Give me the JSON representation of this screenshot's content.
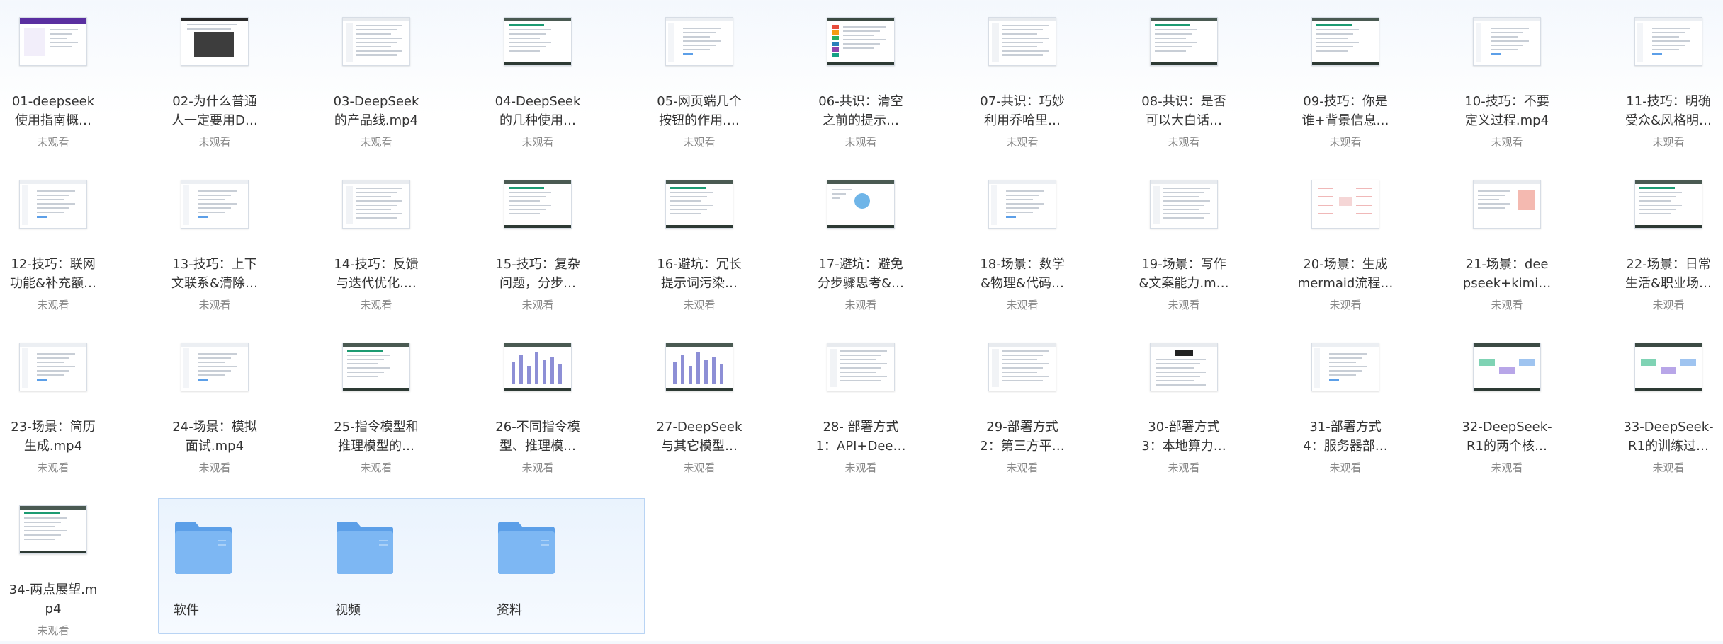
{
  "status_label": "未观看",
  "videos": [
    {
      "line1": "01-deepseek",
      "line2": "使用指南概…",
      "theme": "purple"
    },
    {
      "line1": "02-为什么普通",
      "line2": "人一定要用D…",
      "theme": "photo"
    },
    {
      "line1": "03-DeepSeek",
      "line2": "的产品线.mp4",
      "theme": "doc"
    },
    {
      "line1": "04-DeepSeek",
      "line2": "的几种使用…",
      "theme": "green"
    },
    {
      "line1": "05-网页端几个",
      "line2": "按钮的作用.…",
      "theme": "light"
    },
    {
      "line1": "06-共识：清空",
      "line2": "之前的提示…",
      "theme": "list"
    },
    {
      "line1": "07-共识：巧妙",
      "line2": "利用乔哈里…",
      "theme": "doc"
    },
    {
      "line1": "08-共识：是否",
      "line2": "可以大白话…",
      "theme": "green"
    },
    {
      "line1": "09-技巧：你是",
      "line2": "谁+背景信息…",
      "theme": "green"
    },
    {
      "line1": "10-技巧：不要",
      "line2": "定义过程.mp4",
      "theme": "light"
    },
    {
      "line1": "11-技巧：明确",
      "line2": "受众&风格明…",
      "theme": "light"
    },
    {
      "line1": "12-技巧：联网",
      "line2": "功能&补充额…",
      "theme": "light"
    },
    {
      "line1": "13-技巧：上下",
      "line2": "文联系&清除…",
      "theme": "light"
    },
    {
      "line1": "14-技巧：反馈",
      "line2": "与迭代优化.…",
      "theme": "doc"
    },
    {
      "line1": "15-技巧：复杂",
      "line2": "问题，分步…",
      "theme": "green"
    },
    {
      "line1": "16-避坑：冗长",
      "line2": "提示词污染…",
      "theme": "green"
    },
    {
      "line1": "17-避坑：避免",
      "line2": "分步骤思考&…",
      "theme": "circle"
    },
    {
      "line1": "18-场景：数学",
      "line2": "&物理&代码…",
      "theme": "light"
    },
    {
      "line1": "19-场景：写作",
      "line2": "&文案能力.m…",
      "theme": "doc"
    },
    {
      "line1": "20-场景：生成",
      "line2": "mermaid流程…",
      "theme": "mind"
    },
    {
      "line1": "21-场景：dee",
      "line2": "pseek+kimi…",
      "theme": "pink"
    },
    {
      "line1": "22-场景：日常",
      "line2": "生活&职业场…",
      "theme": "green"
    },
    {
      "line1": "23-场景：简历",
      "line2": "生成.mp4",
      "theme": "light"
    },
    {
      "line1": "24-场景：模拟",
      "line2": "面试.mp4",
      "theme": "light"
    },
    {
      "line1": "25-指令模型和",
      "line2": "推理模型的…",
      "theme": "green"
    },
    {
      "line1": "26-不同指令模",
      "line2": "型、推理模…",
      "theme": "bars"
    },
    {
      "line1": "27-DeepSeek",
      "line2": "与其它模型…",
      "theme": "bars"
    },
    {
      "line1": "28- 部署方式",
      "line2": "1：API+Dee…",
      "theme": "doc"
    },
    {
      "line1": "29-部署方式",
      "line2": "2：第三方平…",
      "theme": "doc"
    },
    {
      "line1": "30-部署方式",
      "line2": "3：本地算力…",
      "theme": "dark"
    },
    {
      "line1": "31-部署方式",
      "line2": "4：服务器部…",
      "theme": "light"
    },
    {
      "line1": "32-DeepSeek-",
      "line2": "R1的两个核…",
      "theme": "flow"
    },
    {
      "line1": "33-DeepSeek-",
      "line2": "R1的训练过…",
      "theme": "flow"
    },
    {
      "line1": "34-两点展望.m",
      "line2": "p4",
      "theme": "green"
    }
  ],
  "folders": [
    {
      "label": "软件"
    },
    {
      "label": "视频"
    },
    {
      "label": "资料"
    }
  ],
  "colors": {
    "folder_front": "#7db7f3",
    "folder_back": "#5c9fe8",
    "selection_border": "#b9d4f4",
    "accent_green": "#1c9b72"
  }
}
